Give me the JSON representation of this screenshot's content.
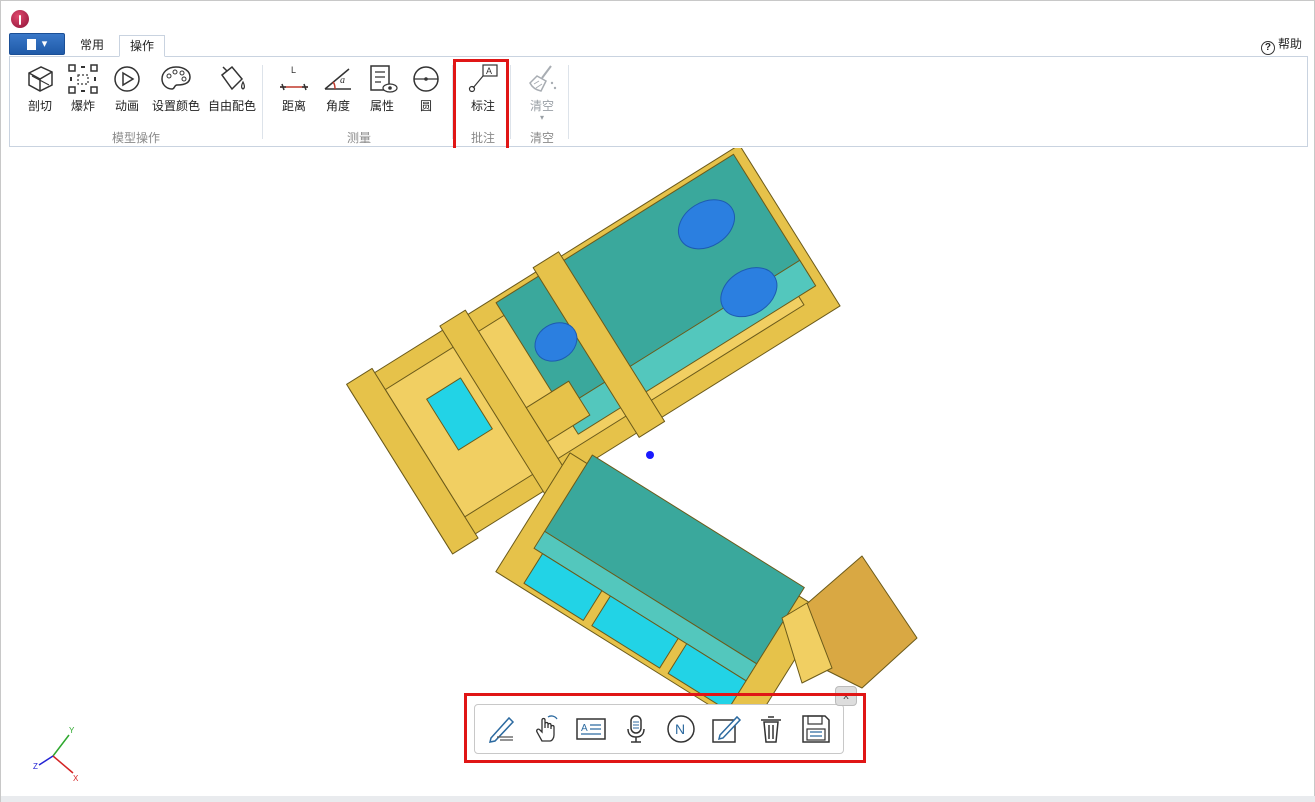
{
  "app": {
    "logo": "app-logo-icon",
    "file_menu": "file-menu-icon"
  },
  "tabs": [
    {
      "label": "常用"
    },
    {
      "label": "操作"
    }
  ],
  "help": {
    "label": "帮助",
    "icon": "help-icon"
  },
  "ribbon": {
    "groups": [
      {
        "label": "模型操作",
        "buttons": [
          {
            "label": "剖切",
            "icon": "section-cut-icon"
          },
          {
            "label": "爆炸",
            "icon": "explode-icon"
          },
          {
            "label": "动画",
            "icon": "animation-play-icon"
          },
          {
            "label": "设置颜色",
            "icon": "palette-icon"
          },
          {
            "label": "自由配色",
            "icon": "paint-bucket-icon"
          }
        ]
      },
      {
        "label": "测量",
        "buttons": [
          {
            "label": "距离",
            "icon": "distance-measure-icon"
          },
          {
            "label": "角度",
            "icon": "angle-measure-icon"
          },
          {
            "label": "属性",
            "icon": "properties-icon"
          },
          {
            "label": "圆",
            "icon": "circle-measure-icon"
          }
        ]
      },
      {
        "label": "批注",
        "buttons": [
          {
            "label": "标注",
            "icon": "annotation-icon"
          }
        ]
      },
      {
        "label": "清空",
        "buttons": [
          {
            "label": "清空",
            "icon": "broom-icon"
          }
        ]
      }
    ]
  },
  "annotation_toolbar": {
    "close_label": "x",
    "tools": [
      "pen-draw-icon",
      "hand-drag-icon",
      "text-note-icon",
      "microphone-icon",
      "note-n-icon",
      "edit-pencil-icon",
      "delete-trash-icon",
      "save-disk-icon"
    ]
  },
  "axes": {
    "x": "X",
    "y": "Y",
    "z": "Z"
  },
  "colors": {
    "highlight_box": "#e01616",
    "model_frame": "#e6c24a",
    "model_cushion": "#3aa89c",
    "model_pillow": "#2b7fe0",
    "model_drawer": "#22d3e6"
  }
}
